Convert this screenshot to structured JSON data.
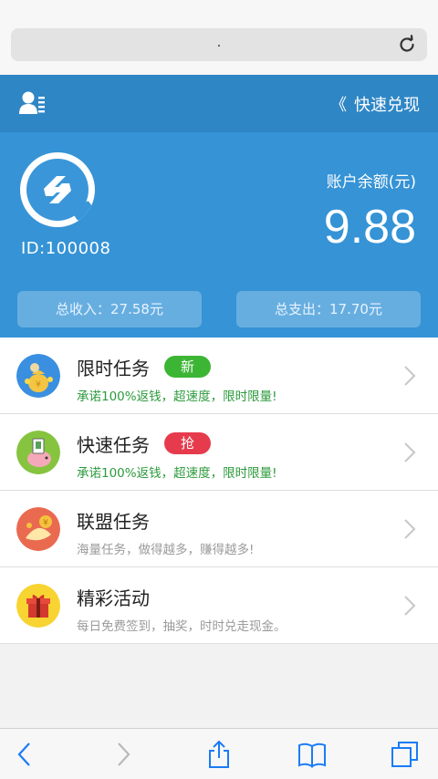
{
  "browser": {
    "url_text": ".",
    "toolbar": {
      "back": "chevron-left-icon",
      "forward": "chevron-right-icon",
      "share": "share-icon",
      "bookmarks": "book-icon",
      "tabs": "tabs-icon"
    }
  },
  "header": {
    "user_icon": "user-list-icon",
    "withdraw_label": "快速兑现",
    "withdraw_arrows": "《"
  },
  "account": {
    "id_text": "ID:100008",
    "balance_label": "账户余额(元)",
    "balance_value": "9.88",
    "income_text": "总收入：27.58元",
    "expense_text": "总支出：17.70元"
  },
  "tasks": [
    {
      "title": "限时任务",
      "badge": "新",
      "subtitle": "承诺100%返钱，超速度，限时限量!",
      "icon": "money-bag-coins-icon"
    },
    {
      "title": "快速任务",
      "badge": "抢",
      "subtitle": "承诺100%返钱，超速度，限时限量!",
      "icon": "piggy-bank-icon"
    },
    {
      "title": "联盟任务",
      "badge": "",
      "subtitle": "海量任务，做得越多，赚得越多!",
      "icon": "fish-coin-icon"
    },
    {
      "title": "精彩活动",
      "badge": "",
      "subtitle": "每日免费签到，抽奖，时时兑走现金。",
      "icon": "gift-box-icon"
    }
  ],
  "colors": {
    "header_blue": "#2f86c5",
    "panel_blue": "#3593d6",
    "badge_green": "#3cb534",
    "badge_red": "#e63b4c",
    "subtitle_green": "#2c9a3c"
  }
}
